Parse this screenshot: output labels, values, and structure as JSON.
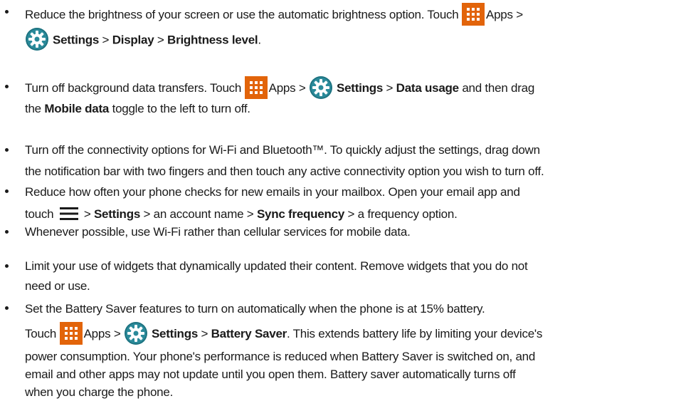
{
  "tips": [
    {
      "lines": [
        [
          "Reduce the brightness of your screen or use the automatic brightness option. Touch ",
          {
            "icon": "apps"
          },
          "Apps > "
        ],
        [
          {
            "icon": "settings"
          },
          {
            "b": "Settings"
          },
          " > ",
          {
            "b": "Display"
          },
          " > ",
          {
            "b": "Brightness level"
          },
          "."
        ]
      ]
    },
    {
      "lines": [
        [
          "Turn off background data transfers. Touch ",
          {
            "icon": "apps"
          },
          "Apps > ",
          {
            "icon": "settings"
          },
          {
            "b": "Settings"
          },
          " > ",
          {
            "b": "Data usage"
          },
          " and then drag"
        ],
        [
          "the ",
          {
            "b": "Mobile data"
          },
          " toggle to the left to turn off."
        ]
      ]
    },
    {
      "lines": [
        [
          "Turn off the connectivity options for Wi-Fi and Bluetooth™. To quickly adjust the settings, drag down"
        ],
        [
          "the notification bar with two fingers and then touch any active connectivity option you wish to turn off."
        ]
      ]
    },
    {
      "lines": [
        [
          "Reduce how often your phone checks for new emails in your mailbox. Open your email app and"
        ],
        [
          "touch ",
          {
            "icon": "menu"
          },
          "> ",
          {
            "b": "Settings"
          },
          " > an account name > ",
          {
            "b": "Sync frequency"
          },
          " > a frequency option."
        ]
      ]
    },
    {
      "lines": [
        [
          "Whenever possible, use Wi-Fi rather than cellular services for mobile data."
        ]
      ]
    },
    {
      "lines": [
        [
          "Limit your use of widgets that dynamically updated their content. Remove widgets that you do not"
        ],
        [
          "need or use."
        ]
      ]
    },
    {
      "lines": [
        [
          "Set the Battery Saver features to turn on automatically when the phone is at 15% battery."
        ],
        [
          "Touch ",
          {
            "icon": "apps"
          },
          "Apps > ",
          {
            "icon": "settings"
          },
          {
            "b": "Settings"
          },
          " > ",
          {
            "b": "Battery Saver"
          },
          ". This extends battery life by limiting your device's"
        ],
        [
          "power consumption. Your phone's performance is reduced when Battery Saver is switched on, and"
        ],
        [
          "email and other apps may not update until you open them. Battery saver automatically turns off"
        ],
        [
          "when you charge the phone."
        ]
      ]
    }
  ],
  "colors": {
    "apps_icon_bg": "#e2640a",
    "settings_icon_bg": "#2a8a9a",
    "text": "#1a1a1a"
  },
  "icons": {
    "apps": "apps-grid-icon",
    "settings": "settings-gear-icon",
    "menu": "menu-icon"
  }
}
